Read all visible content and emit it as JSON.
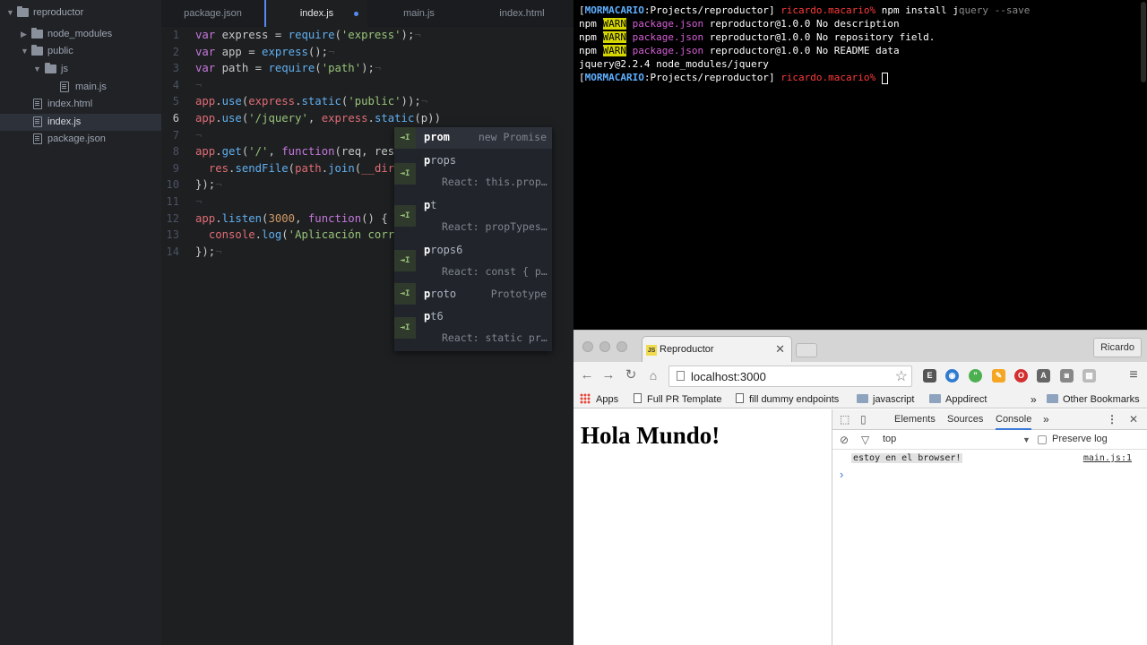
{
  "editor": {
    "tree": {
      "root": "reproductor",
      "items": [
        "node_modules",
        "public",
        "js",
        "main.js",
        "index.html",
        "index.js",
        "package.json"
      ]
    },
    "tabs": [
      "package.json",
      "index.js",
      "main.js",
      "index.html"
    ],
    "line_numbers": [
      "1",
      "2",
      "3",
      "4",
      "5",
      "6",
      "7",
      "8",
      "9",
      "10",
      "11",
      "12",
      "13",
      "14"
    ],
    "autocomplete": {
      "items": [
        {
          "match": "p",
          "rest": "rom",
          "right": "new Promise",
          "desc": ""
        },
        {
          "match": "p",
          "rest": "rops",
          "right": "",
          "desc": "React: this.prop…"
        },
        {
          "match": "p",
          "rest": "t",
          "right": "",
          "desc": "React: propTypes…"
        },
        {
          "match": "p",
          "rest": "rops6",
          "right": "",
          "desc": "React: const { p…"
        },
        {
          "match": "p",
          "rest": "roto",
          "right": "Prototype",
          "desc": ""
        },
        {
          "match": "p",
          "rest": "t6",
          "right": "",
          "desc": "React: static pr…"
        }
      ]
    }
  },
  "terminal": {
    "host": "MORMACARIO",
    "path": ":Projects/reproductor",
    "user": "ricardo.macario",
    "prompt_symbol": "%",
    "command": "npm install j",
    "command_rest": "query --save",
    "warn_lines": [
      "reproductor@1.0.0 No description",
      "reproductor@1.0.0 No repository field.",
      "reproductor@1.0.0 No README data"
    ],
    "npm": "npm",
    "warn": "WARN",
    "pkg": "package.json",
    "result": "jquery@2.2.4 node_modules/jquery"
  },
  "browser": {
    "tab_title": "Reproductor",
    "favicon": "JS",
    "user_button": "Ricardo",
    "url": "localhost:3000",
    "bookmarks": [
      "Apps",
      "Full PR Template",
      "fill dummy endpoints",
      "javascript",
      "Appdirect"
    ],
    "bookmarks_overflow": "»",
    "other_bookmarks": "Other Bookmarks",
    "page_heading": "Hola Mundo!",
    "devtools": {
      "tabs": [
        "Elements",
        "Sources",
        "Console"
      ],
      "more": "»",
      "context": "top",
      "preserve_log": "Preserve log",
      "message": "estoy en el browser!",
      "source": "main.js:1",
      "prompt": "›"
    }
  }
}
